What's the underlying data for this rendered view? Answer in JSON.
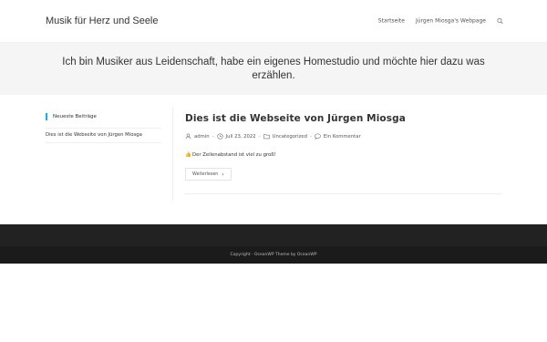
{
  "header": {
    "site_title": "Musik für Herz und Seele",
    "nav": [
      {
        "label": "Startseite"
      },
      {
        "label": "Jürgen Miosga's Webpage"
      }
    ],
    "search_icon": "search-icon"
  },
  "hero": {
    "text": "Ich bin Musiker aus Leidenschaft, habe ein eigenes Homestudio und möchte hier dazu was erzählen."
  },
  "sidebar": {
    "widget_title": "Neueste Beiträge",
    "recent_posts": [
      "Dies ist die Webseite von Jürgen Miosga"
    ],
    "accent_color": "#13aff0"
  },
  "post": {
    "title": "Dies ist die Webseite von Jürgen Miosga",
    "author": "admin",
    "date": "Juli 23, 2022",
    "category": "Uncategorized",
    "comments": "Ein Kommentar",
    "excerpt_emoji": "👍",
    "excerpt": "Der Zeilenabstand ist viel zu groß!",
    "read_more": "Weiterlesen",
    "meta_separator": "-"
  },
  "footer": {
    "copyright": "Copyright - OceanWP Theme by OceanWP"
  }
}
